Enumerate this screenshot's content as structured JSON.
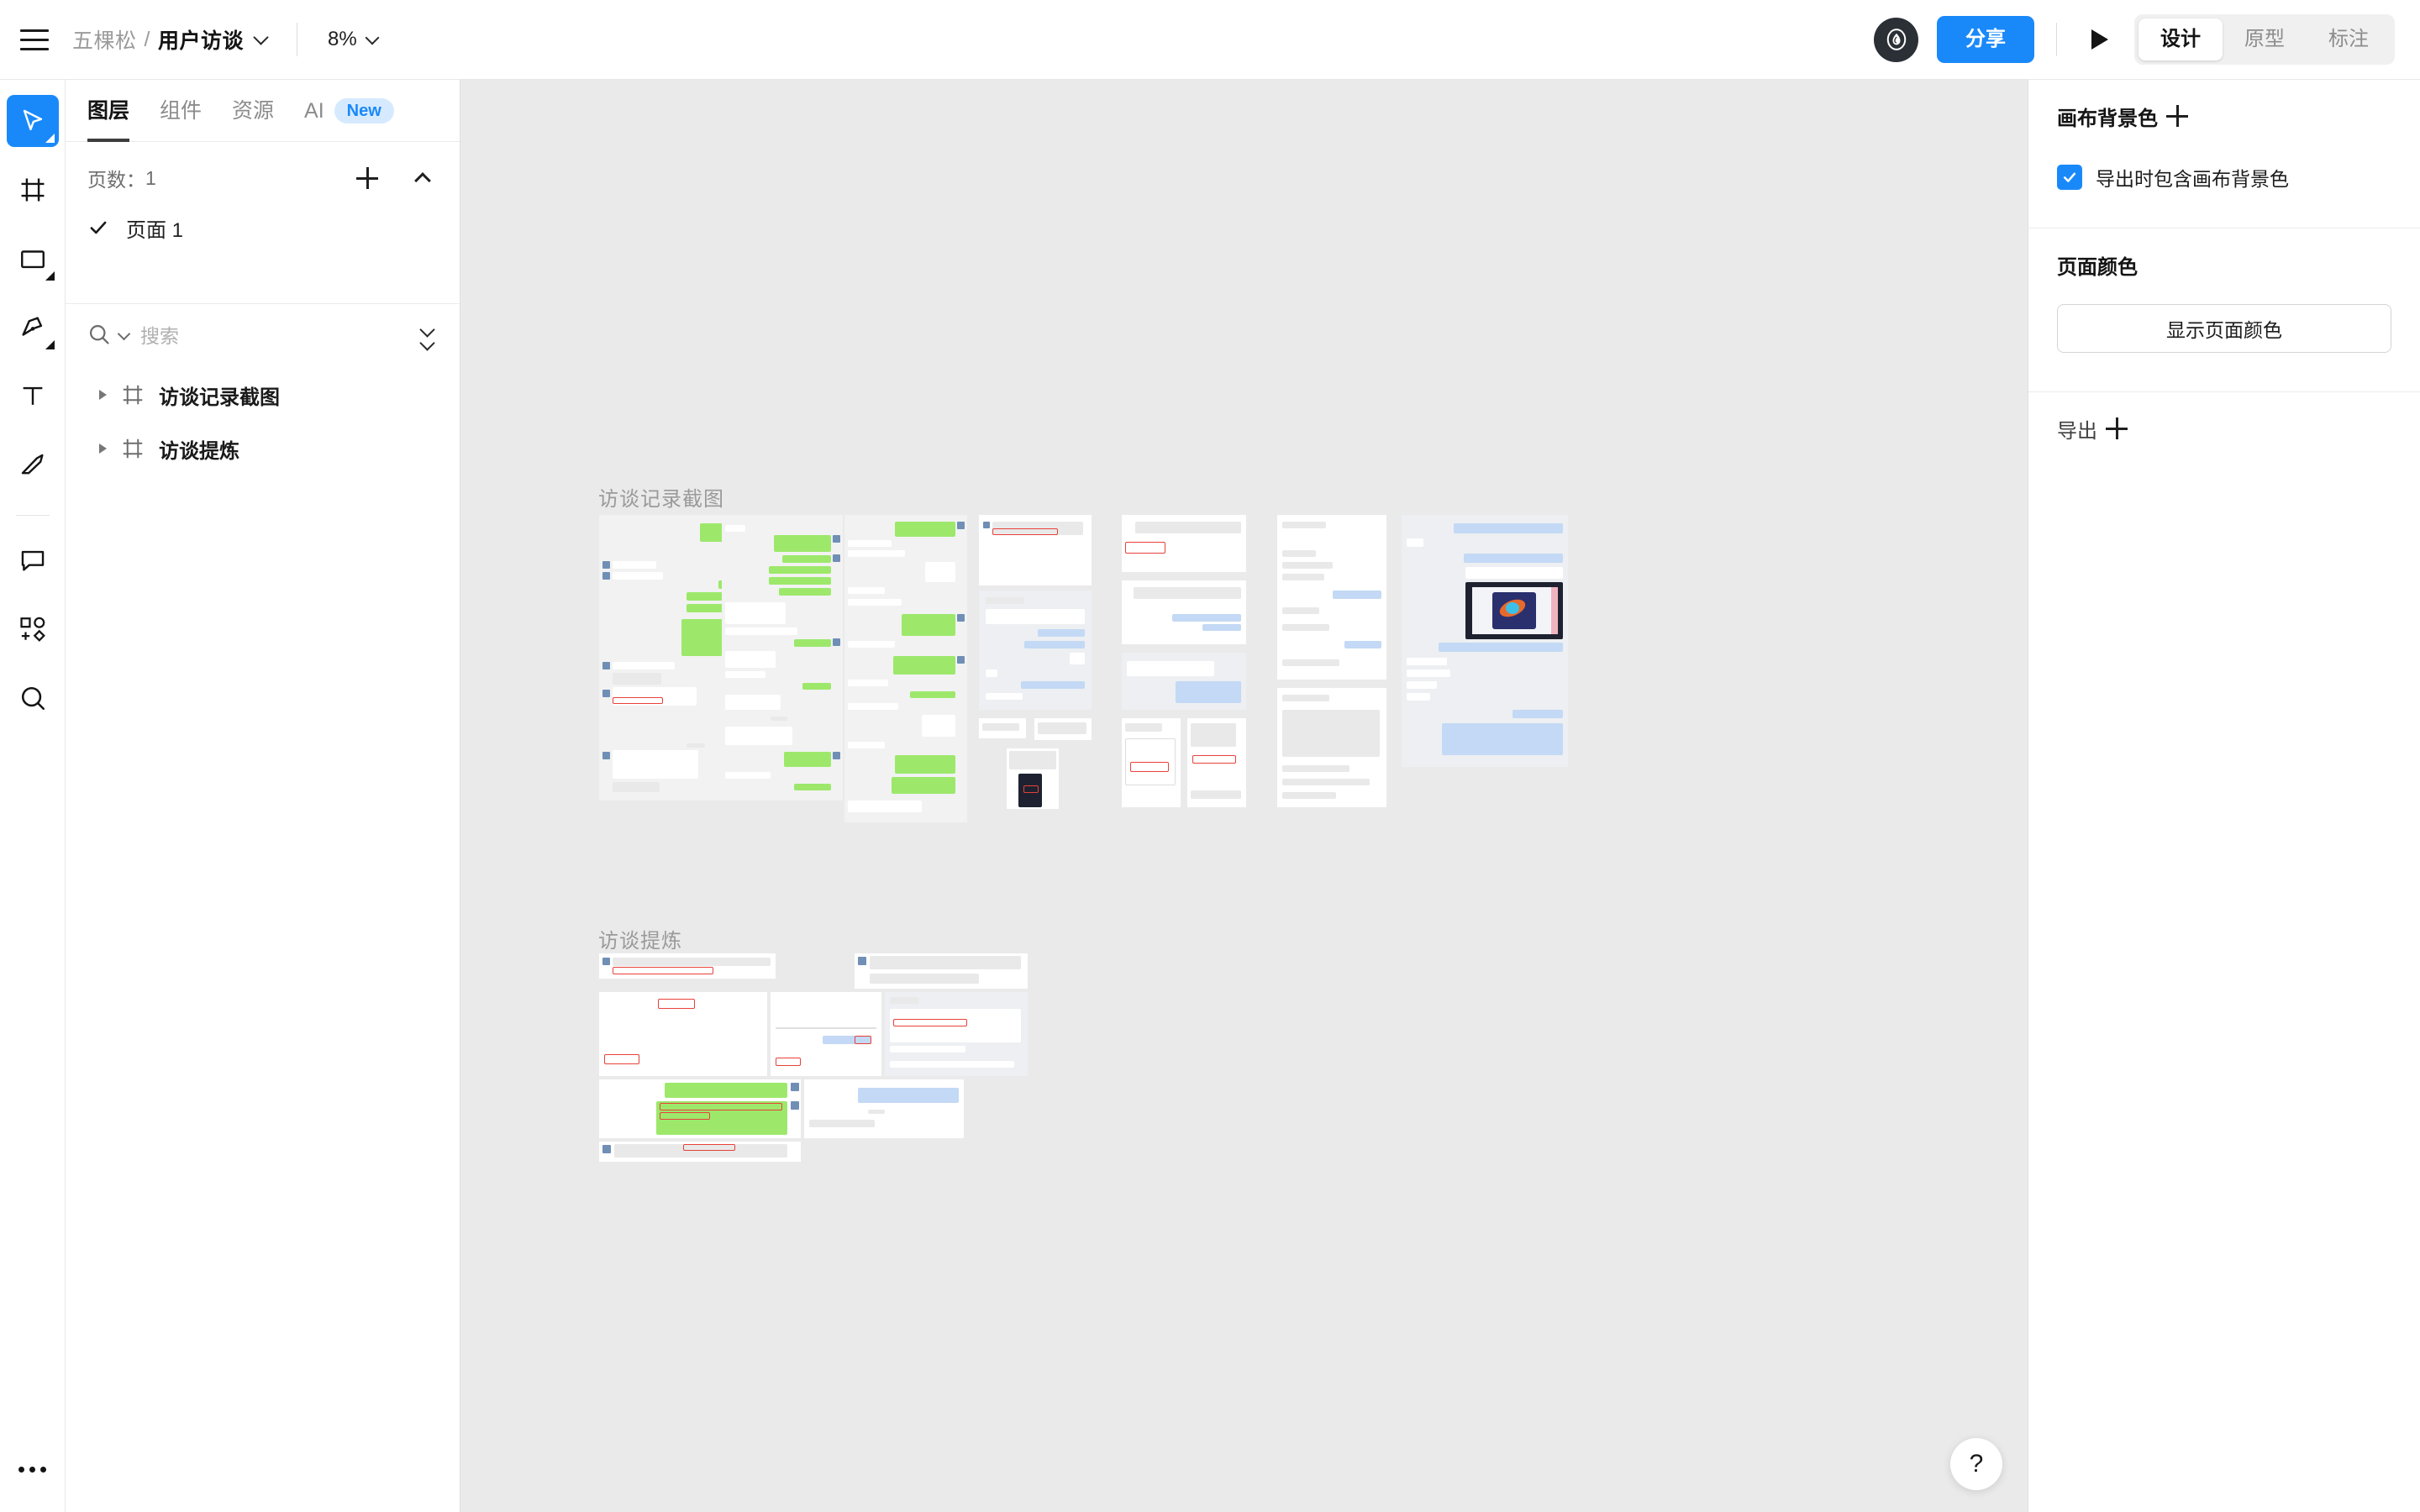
{
  "header": {
    "menu_icon": "hamburger-icon",
    "breadcrumb": {
      "team": "五棵松",
      "separator": "/",
      "file": "用户访谈"
    },
    "zoom": "8%",
    "share_label": "分享",
    "play_icon": "play-icon",
    "modes": [
      {
        "label": "设计",
        "active": true
      },
      {
        "label": "原型",
        "active": false
      },
      {
        "label": "标注",
        "active": false
      }
    ],
    "accent_color": "#1989fa"
  },
  "toolbar": {
    "tools": [
      {
        "name": "cursor-tool",
        "active": true
      },
      {
        "name": "frame-tool",
        "active": false
      },
      {
        "name": "rectangle-tool",
        "active": false
      },
      {
        "name": "pen-tool",
        "active": false
      },
      {
        "name": "text-tool",
        "active": false
      },
      {
        "name": "slice-tool",
        "active": false
      },
      {
        "name": "comment-tool",
        "active": false
      },
      {
        "name": "plugin-tool",
        "active": false
      },
      {
        "name": "zoom-tool",
        "active": false
      }
    ],
    "more_label": "..."
  },
  "left_panel": {
    "tabs": [
      {
        "label": "图层",
        "active": true
      },
      {
        "label": "组件",
        "active": false
      },
      {
        "label": "资源",
        "active": false
      },
      {
        "label": "AI",
        "active": false,
        "badge": "New"
      }
    ],
    "pages": {
      "count_label": "页数：",
      "count": "1",
      "add_icon": "plus-icon",
      "collapse_icon": "chevron-up-icon",
      "items": [
        {
          "name": "页面 1",
          "selected": true
        }
      ]
    },
    "search": {
      "placeholder": "搜索",
      "value": ""
    },
    "layers": [
      {
        "name": "访谈记录截图",
        "type": "frame",
        "expanded": false
      },
      {
        "name": "访谈提炼",
        "type": "frame",
        "expanded": false
      }
    ]
  },
  "canvas": {
    "background_color": "#eaeaea",
    "frames": [
      {
        "label": "访谈记录截图"
      },
      {
        "label": "访谈提炼"
      }
    ]
  },
  "right_panel": {
    "canvas_bg": {
      "title": "画布背景色",
      "add_icon": "plus-icon"
    },
    "export_bg_checkbox": {
      "label": "导出时包含画布背景色",
      "checked": true
    },
    "page_color": {
      "title": "页面颜色",
      "button_label": "显示页面颜色"
    },
    "export": {
      "title": "导出",
      "add_icon": "plus-icon"
    }
  },
  "help": {
    "label": "?"
  }
}
